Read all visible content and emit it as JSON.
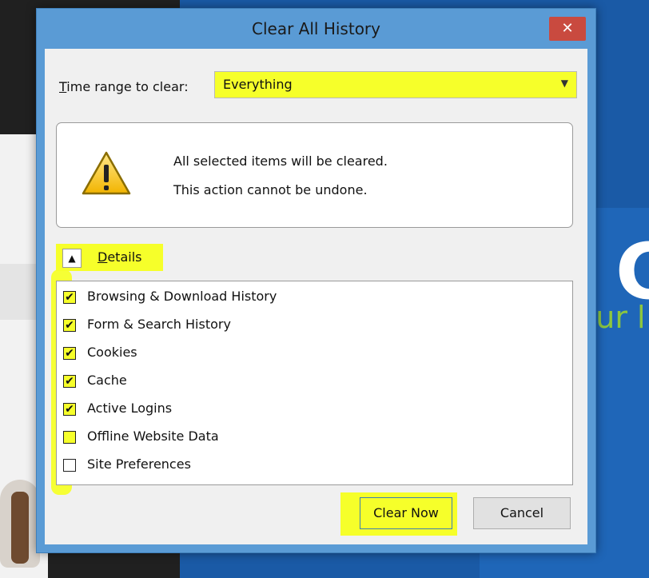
{
  "dialog": {
    "title": "Clear All History",
    "close_glyph": "✕"
  },
  "time_range": {
    "label_accel": "T",
    "label_rest": "ime range to clear:",
    "value": "Everything",
    "arrow": "▼"
  },
  "warning": {
    "icon": "warning-icon",
    "line1": "All selected items will be cleared.",
    "line2": "This action cannot be undone."
  },
  "details": {
    "chevron": "▲",
    "label_accel": "D",
    "label_rest": "etails"
  },
  "items": [
    {
      "label": "Browsing & Download History",
      "checked": true
    },
    {
      "label": "Form & Search History",
      "checked": true
    },
    {
      "label": "Cookies",
      "checked": true
    },
    {
      "label": "Cache",
      "checked": true
    },
    {
      "label": "Active Logins",
      "checked": true
    },
    {
      "label": "Offline Website Data",
      "checked": false
    },
    {
      "label": "Site Preferences",
      "checked": false
    }
  ],
  "buttons": {
    "clear_now": "Clear Now",
    "cancel": "Cancel"
  },
  "check_glyph": "✔",
  "background": {
    "big_letter": "C",
    "green_text": "our l"
  },
  "colors": {
    "highlight": "#f6ff2a",
    "titlebar": "#5a9bd5",
    "close": "#c94a3f",
    "background_blue": "#1a5aa6"
  }
}
